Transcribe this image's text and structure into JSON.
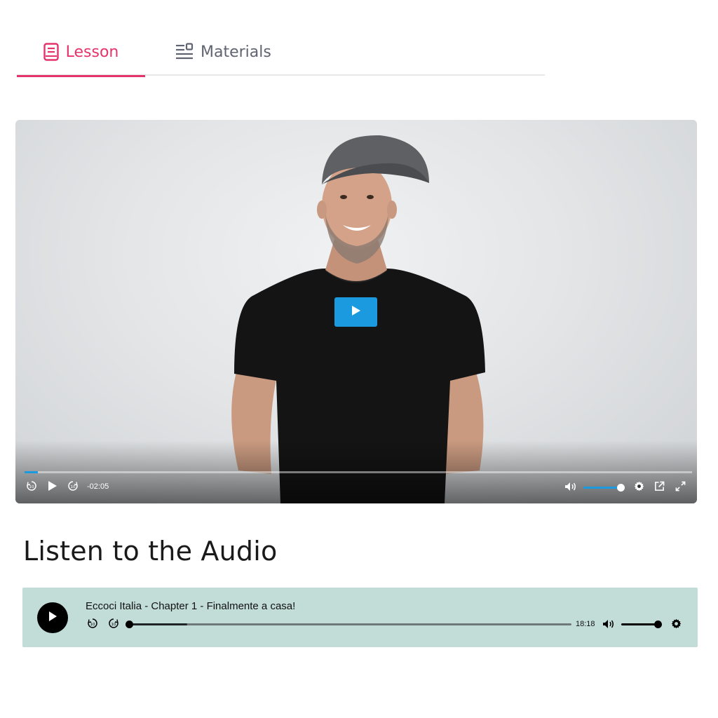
{
  "tabs": [
    {
      "label": "Lesson",
      "icon": "book-icon",
      "active": true
    },
    {
      "label": "Materials",
      "icon": "list-icon",
      "active": false
    }
  ],
  "video": {
    "time_remaining": "-02:05",
    "progress_fraction": 0.02,
    "volume_fraction": 1.0,
    "accent_color": "#1c9ae0"
  },
  "section": {
    "title": "Listen to the Audio"
  },
  "audio": {
    "title": "Eccoci Italia -  Chapter 1 - Finalmente a casa!",
    "duration": "18:18",
    "progress_fraction": 0.0,
    "buffered_fraction": 0.13,
    "volume_fraction": 1.0,
    "background_color": "#c2ddd8"
  },
  "colors": {
    "accent_pink": "#e5336b",
    "tab_gray": "#5f6470"
  }
}
